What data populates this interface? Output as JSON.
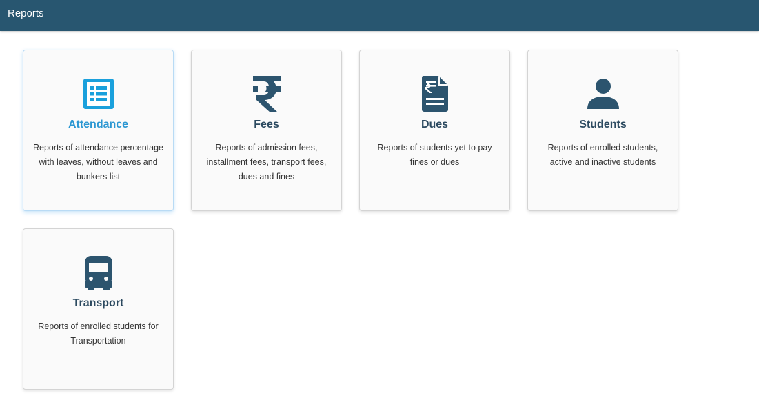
{
  "header": {
    "title": "Reports"
  },
  "colors": {
    "header_bg": "#285670",
    "icon": "#2c546e",
    "active_icon": "#1aa0dc",
    "active_title": "#2b97d2"
  },
  "cards": [
    {
      "title": "Attendance",
      "icon": "list-icon",
      "description": "Reports of attendance percentage with leaves, without leaves and bunkers list",
      "active": true
    },
    {
      "title": "Fees",
      "icon": "rupee-icon",
      "description": "Reports of admission fees, installment fees, transport fees, dues and fines"
    },
    {
      "title": "Dues",
      "icon": "rupee-document-icon",
      "description": "Reports of students yet to pay fines or dues"
    },
    {
      "title": "Students",
      "icon": "person-icon",
      "description": "Reports of enrolled students, active and inactive students"
    },
    {
      "title": "Transport",
      "icon": "bus-icon",
      "description": "Reports of enrolled students for Transportation"
    }
  ]
}
